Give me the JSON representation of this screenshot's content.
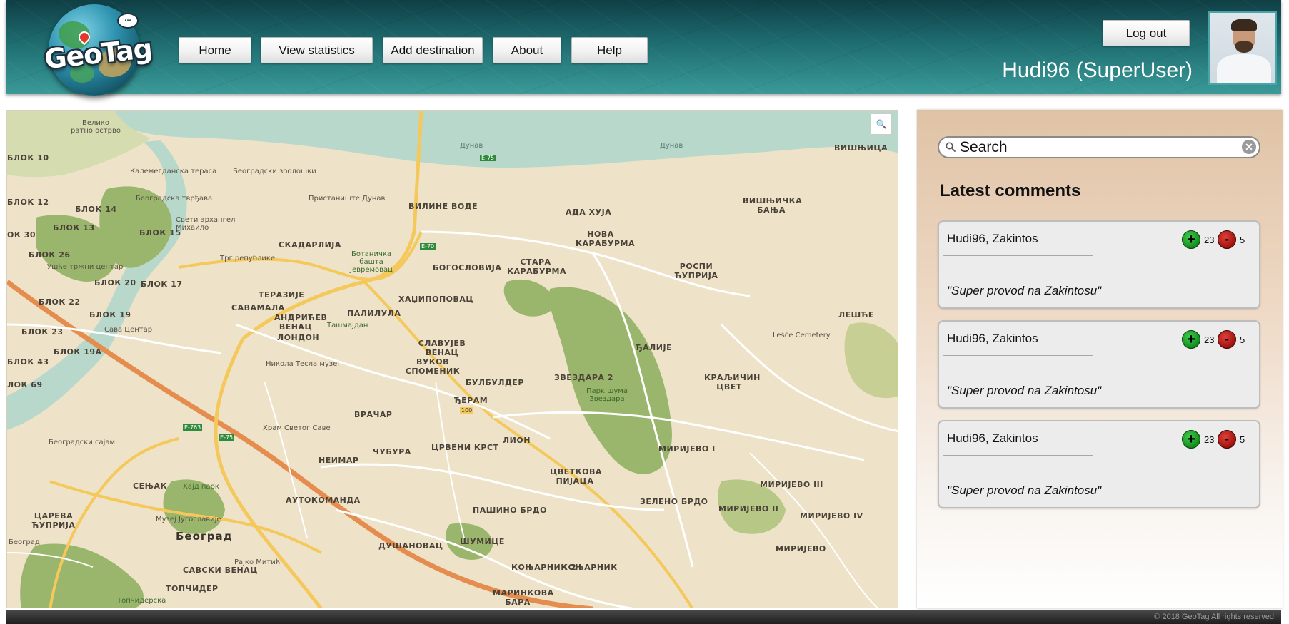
{
  "app": {
    "logo_text": "GeoTag",
    "logo_bubble": "..."
  },
  "nav": [
    {
      "label": "Home"
    },
    {
      "label": "View statistics"
    },
    {
      "label": "Add destination"
    },
    {
      "label": "About"
    },
    {
      "label": "Help"
    }
  ],
  "user": {
    "logout_label": "Log out",
    "display_name": "Hudi96 (SuperUser)"
  },
  "map": {
    "zoom_icon": "magnifier-icon",
    "zoom_glyph": "🔍",
    "labels": {
      "veliko": "Велико ратно острво",
      "blok10": "БЛОК 10",
      "blok12": "БЛОК 12",
      "blok14": "БЛОК 14",
      "blok13": "БЛОК 13",
      "blok15": "БЛОК 15",
      "blok30": "ОК 30",
      "blok26": "БЛОК 26",
      "blok20": "БЛОК 20",
      "blok17": "БЛОК 17",
      "blok22": "БЛОК 22",
      "blok19": "БЛОК 19",
      "blok23": "БЛОК 23",
      "blok19a": "БЛОК 19А",
      "blok43": "БЛОК 43",
      "blok69": "ЛОК 69",
      "kalemegdan": "Калемегданска тераса",
      "zoo": "Београдски зоолошки",
      "tvrdjava": "Београдска тврђава",
      "sveti": "Свети архангел Михаило",
      "pristaniste": "Пристаниште Дунав",
      "usce": "Ушће тржни центар",
      "trg": "Трг републике",
      "skadarlija": "СКАДАРЛИЈА",
      "vilinevode": "ВИЛИНЕ ВОДЕ",
      "adahuja": "АДА ХУЈА",
      "nova_karaburma": "НОВА КАРАБУРМА",
      "stara_karaburma": "СТАРА КАРАБУРМА",
      "bogoslovija": "БОГОСЛОВИЈА",
      "botanicka": "Ботаничка башта Јевремовац",
      "rospi": "РОСПИ ЋУПРИЈА",
      "visnjica": "ВИШЊИЦА",
      "visnjicka": "ВИШЊИЧКА БАЊА",
      "terazije": "ТЕРАЗИЈЕ",
      "savamala": "САВАМАЛА",
      "andricev": "АНДРИЋЕВ ВЕНАЦ",
      "palilula": "ПАЛИЛУЛА",
      "tasmajdan": "Ташмајдан",
      "london": "ЛОНДОН",
      "hadzipopovac": "ХАЏИПОПОВАЦ",
      "slavujev": "СЛАВУЈЕВ ВЕНАЦ",
      "vukov": "ВУКОВ СПОМЕНИК",
      "bulbulder": "БУЛБУЛДЕР",
      "zvezdara2": "ЗВЕЗДАРА 2",
      "park_zvezdara": "Парк шума Звездара",
      "kalije": "ЂАЛИЈЕ",
      "kraljicin": "КРАЉИЧИН ЦВЕТ",
      "lesce": "ЛЕШЋЕ",
      "lesce_cem": "Lešće Cemetery",
      "sava_centar": "Сава Центар",
      "tesla": "Никола Тесла музеј",
      "djeram": "ЂЕРАМ",
      "vracar": "ВРАЧАР",
      "hram": "Храм Светог Саве",
      "crveni": "ЦРВЕНИ КРСТ",
      "lion": "ЛИОН",
      "mirijevo1": "МИРИЈЕВО I",
      "neimar": "НЕИМАР",
      "cubura": "ЧУБУРА",
      "cvetkova": "ЦВЕТКОВА ПИЈАЦА",
      "mirijevo3": "МИРИЈЕВО III",
      "sajam": "Београдски сајам",
      "senjak": "СЕЊАК",
      "hajd": "Хајд парк",
      "autokomanda": "АУТОКОМАНДА",
      "zeleno": "ЗЕЛЕНО БРДО",
      "mirijevo2": "МИРИЈЕВО II",
      "mirijevo4": "МИРИЈЕВО IV",
      "careva": "ЦАРЕВА ЋУПРИЈА",
      "muzej_jug": "Музеј Југославије",
      "pasino": "ПАШИНО БРДО",
      "mirijevo": "МИРИЈЕВО",
      "beograd_small": "Београд",
      "beograd": "Београд",
      "dusanovac": "ДУШАНОВАЦ",
      "sumice": "ШУМИЦЕ",
      "savski": "САВСКИ ВЕНАЦ",
      "rajko": "Рајко Митић",
      "konjarnik2": "КОЊАРНИК 2",
      "konjarnik": "КОЊАРНИК",
      "topcider": "ТОПЧИДЕР",
      "topciderska": "Топчидерска",
      "marinkova": "МАРИНКОВА БАРА",
      "dunav1": "Дунав",
      "dunav2": "Дунав",
      "e75a": "E-75",
      "e75b": "E-75",
      "e70": "E-70",
      "e763": "E-763",
      "r100": "100"
    }
  },
  "sidebar": {
    "search_placeholder": "Search",
    "clear_glyph": "✕",
    "latest_title": "Latest comments",
    "comments": [
      {
        "author_place": "Hudi96, Zakintos",
        "text": "\"Super provod na Zakintosu\"",
        "up_glyph": "+",
        "down_glyph": "-",
        "up": "23",
        "down": "5"
      },
      {
        "author_place": "Hudi96, Zakintos",
        "text": "\"Super provod na Zakintosu\"",
        "up_glyph": "+",
        "down_glyph": "-",
        "up": "23",
        "down": "5"
      },
      {
        "author_place": "Hudi96, Zakintos",
        "text": "\"Super provod na Zakintosu\"",
        "up_glyph": "+",
        "down_glyph": "-",
        "up": "23",
        "down": "5"
      }
    ]
  },
  "footer": {
    "copyright": "© 2018 GeoTag All rights reserved"
  },
  "colors": {
    "header_dark": "#0f3f45",
    "header_light": "#3a9a98",
    "vote_up": "#138a1e",
    "vote_down": "#a0110d",
    "map_land": "#eee3c8",
    "map_water": "#b9d8cc",
    "map_park": "#9ab66c",
    "map_highway": "#e58d4e",
    "map_main_road": "#f4c85a"
  }
}
